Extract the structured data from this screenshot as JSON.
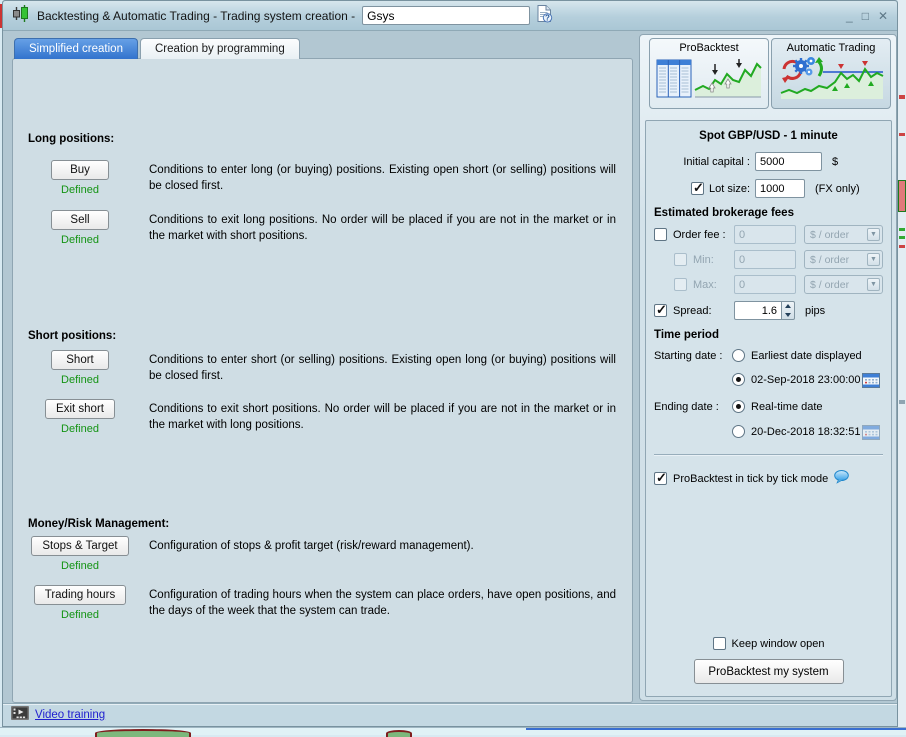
{
  "window": {
    "title": "Backtesting & Automatic Trading - Trading system creation  -",
    "system_name": "Gsys",
    "controls": {
      "minimize": "_",
      "maximize": "□",
      "close": "✕"
    }
  },
  "tabs": {
    "simplified": "Simplified creation",
    "programming": "Creation by programming"
  },
  "left": {
    "sections": [
      {
        "heading": "Long positions:",
        "rows": [
          {
            "button": "Buy",
            "status": "Defined",
            "desc": "Conditions to enter long (or buying) positions. Existing open short (or selling) positions will be closed first."
          },
          {
            "button": "Sell",
            "status": "Defined",
            "desc": "Conditions to exit long positions.  No order will be placed if you are not in the market or in the market with short positions."
          }
        ]
      },
      {
        "heading": "Short positions:",
        "rows": [
          {
            "button": "Short",
            "status": "Defined",
            "desc": "Conditions to enter short (or selling) positions. Existing open long (or buying) positions will be closed first."
          },
          {
            "button": "Exit short",
            "status": "Defined",
            "desc": "Conditions to exit short positions.  No order will be placed if you are not in the market or in the market with long positions."
          }
        ]
      },
      {
        "heading": "Money/Risk Management:",
        "rows": [
          {
            "button": "Stops & Target",
            "status": "Defined",
            "desc": "Configuration of stops & profit target (risk/reward management)."
          },
          {
            "button": "Trading hours",
            "status": "Defined",
            "desc": "Configuration of trading hours when the system can place orders, have open positions, and the days of the week that the system can trade."
          }
        ]
      }
    ]
  },
  "right": {
    "tabs": {
      "probacktest": "ProBacktest",
      "auto_trading": "Automatic Trading"
    },
    "instrument": "Spot GBP/USD - 1 minute",
    "initial_capital": {
      "label": "Initial capital :",
      "value": "5000",
      "unit": "$"
    },
    "lot_size": {
      "label": "Lot size:",
      "value": "1000",
      "unit": "(FX only)"
    },
    "fees_heading": "Estimated brokerage fees",
    "order_fee": {
      "label": "Order fee :",
      "value": "0",
      "unit": "$ / order"
    },
    "min_fee": {
      "label": "Min:",
      "value": "0",
      "unit": "$ / order"
    },
    "max_fee": {
      "label": "Max:",
      "value": "0",
      "unit": "$ / order"
    },
    "spread": {
      "label": "Spread:",
      "value": "1.6",
      "unit": "pips"
    },
    "time_period_heading": "Time period",
    "starting_date": {
      "label": "Starting date :",
      "option1": "Earliest date displayed",
      "option2": "02-Sep-2018 23:00:00"
    },
    "ending_date": {
      "label": "Ending date :",
      "option1": "Real-time date",
      "option2": "20-Dec-2018 18:32:51"
    },
    "tick_mode_label": "ProBacktest in tick by tick mode",
    "keep_window_label": "Keep window open",
    "run_button": "ProBacktest my system"
  },
  "footer": {
    "video_link": "Video training"
  },
  "colors": {
    "defined_green": "#149414",
    "active_tab_blue": "#3273cd",
    "link_blue": "#2121cf"
  }
}
